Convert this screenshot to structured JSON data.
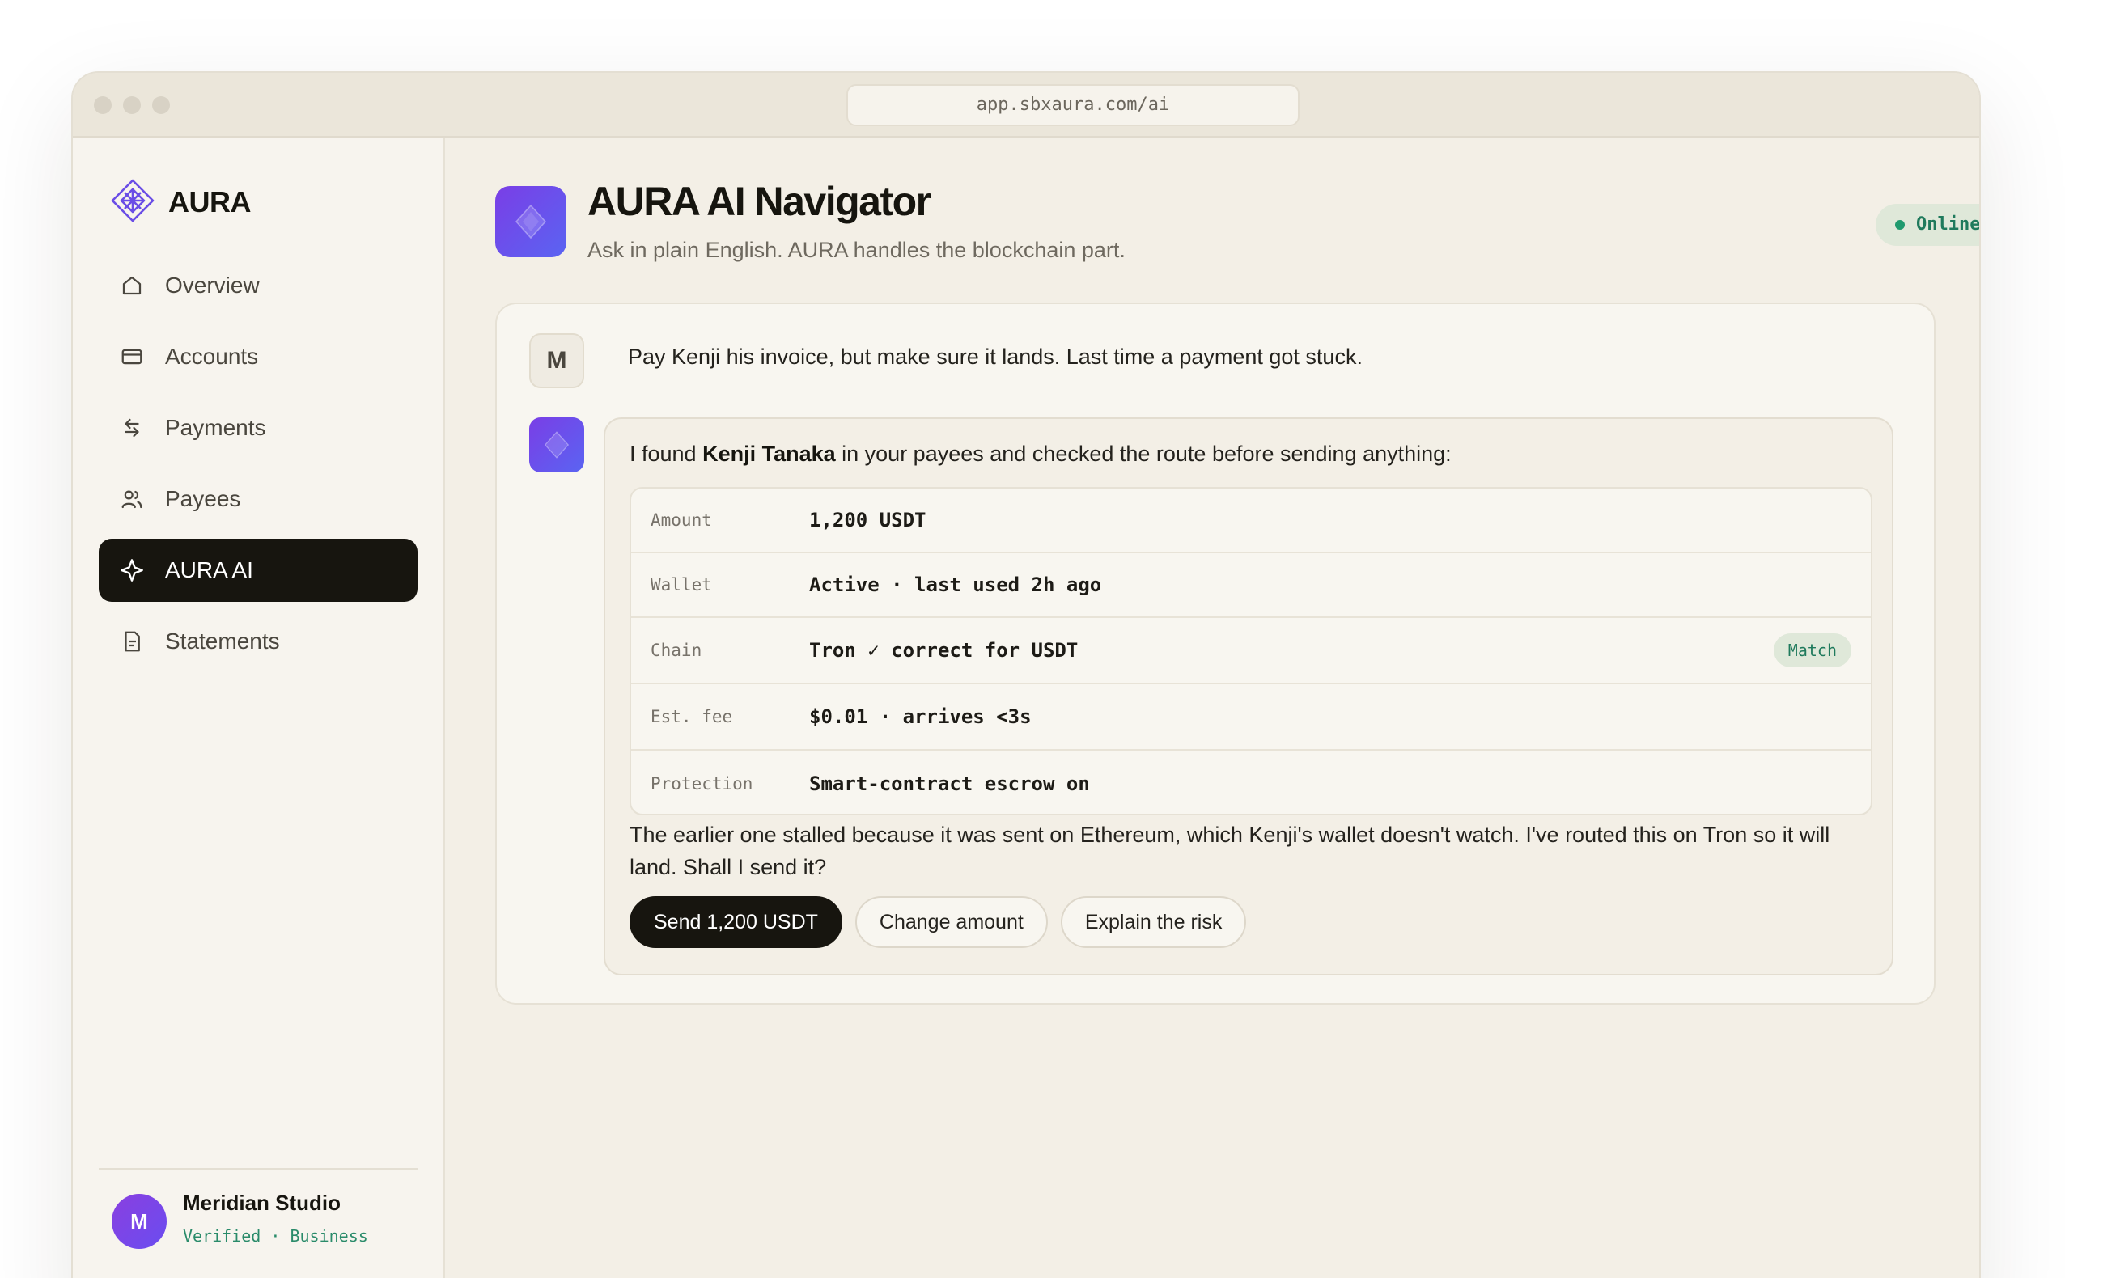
{
  "browser": {
    "url": "app.sbxaura.com/ai"
  },
  "brand": {
    "name": "AURA"
  },
  "sidebar": {
    "items": [
      {
        "label": "Overview",
        "icon": "home-icon"
      },
      {
        "label": "Accounts",
        "icon": "card-icon"
      },
      {
        "label": "Payments",
        "icon": "transfer-icon"
      },
      {
        "label": "Payees",
        "icon": "people-icon"
      },
      {
        "label": "AURA AI",
        "icon": "sparkle-icon",
        "active": true
      },
      {
        "label": "Statements",
        "icon": "document-icon"
      }
    ],
    "user": {
      "initial": "M",
      "name": "Meridian Studio",
      "status": "Verified · Business"
    }
  },
  "header": {
    "title": "AURA AI Navigator",
    "subtitle": "Ask in plain English. AURA handles the blockchain part.",
    "status": "Online"
  },
  "chat": {
    "user_initial": "M",
    "user_message": "Pay Kenji his invoice, but make sure it lands. Last time a payment got stuck.",
    "ai": {
      "intro_before": "I found ",
      "intro_name": "Kenji Tanaka",
      "intro_after": " in your payees and checked the route before sending anything:",
      "facts": [
        {
          "label": "Amount",
          "value": "1,200 USDT"
        },
        {
          "label": "Wallet",
          "value": "Active · last used 2h ago"
        },
        {
          "label": "Chain",
          "value": "Tron ✓ correct for USDT",
          "badge": "Match"
        },
        {
          "label": "Est. fee",
          "value": "$0.01 · arrives <3s"
        },
        {
          "label": "Protection",
          "value": "Smart-contract escrow on"
        }
      ],
      "note": "The earlier one stalled because it was sent on Ethereum, which Kenji's wallet doesn't watch. I've routed this on Tron so it will land. Shall I send it?",
      "actions": {
        "send": "Send 1,200 USDT",
        "change": "Change amount",
        "explain": "Explain the risk"
      }
    }
  },
  "colors": {
    "accent": "#7a3ee6",
    "accent2": "#5a64f2",
    "success": "#1f7a5c",
    "dark": "#17150f",
    "background": "#f3efe6"
  }
}
